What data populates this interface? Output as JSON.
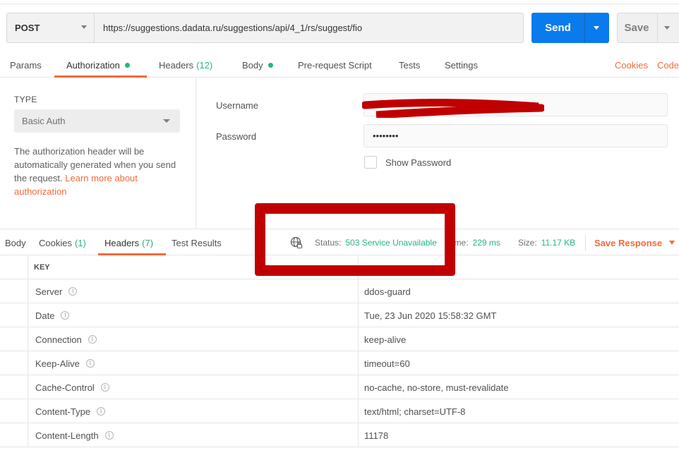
{
  "request": {
    "method": "POST",
    "url": "https://suggestions.dadata.ru/suggestions/api/4_1/rs/suggest/fio",
    "send_label": "Send",
    "save_label": "Save"
  },
  "request_tabs": {
    "params": "Params",
    "authorization": "Authorization",
    "headers": "Headers",
    "headers_count": "(12)",
    "body": "Body",
    "prerequest": "Pre-request Script",
    "tests": "Tests",
    "settings": "Settings",
    "cookies": "Cookies",
    "code": "Code"
  },
  "auth": {
    "type_label": "TYPE",
    "type_value": "Basic Auth",
    "description": "The authorization header will be automatically generated when you send the request. ",
    "learn_more": "Learn more about authorization",
    "username_label": "Username",
    "username_value": "",
    "password_label": "Password",
    "password_value": "••••••••",
    "show_password_label": "Show Password"
  },
  "response_tabs": {
    "body": "Body",
    "cookies": "Cookies",
    "cookies_count": "(1)",
    "headers": "Headers",
    "headers_count": "(7)",
    "test_results": "Test Results"
  },
  "response_meta": {
    "status_label": "Status:",
    "status_value": "503 Service Unavailable",
    "time_label": "Time:",
    "time_value": "229 ms",
    "size_label": "Size:",
    "size_value": "11.17 KB",
    "save_response": "Save Response"
  },
  "headers_table": {
    "key_header": "KEY",
    "rows": [
      {
        "key": "Server",
        "value": "ddos-guard"
      },
      {
        "key": "Date",
        "value": "Tue, 23 Jun 2020 15:58:32 GMT"
      },
      {
        "key": "Connection",
        "value": "keep-alive"
      },
      {
        "key": "Keep-Alive",
        "value": "timeout=60"
      },
      {
        "key": "Cache-Control",
        "value": "no-cache, no-store, must-revalidate"
      },
      {
        "key": "Content-Type",
        "value": "text/html; charset=UTF-8"
      },
      {
        "key": "Content-Length",
        "value": "11178"
      }
    ]
  },
  "colors": {
    "accent_orange": "#f26b3a",
    "send_blue": "#097bed",
    "status_green": "#26b47f",
    "annotation_red": "#c00000"
  }
}
